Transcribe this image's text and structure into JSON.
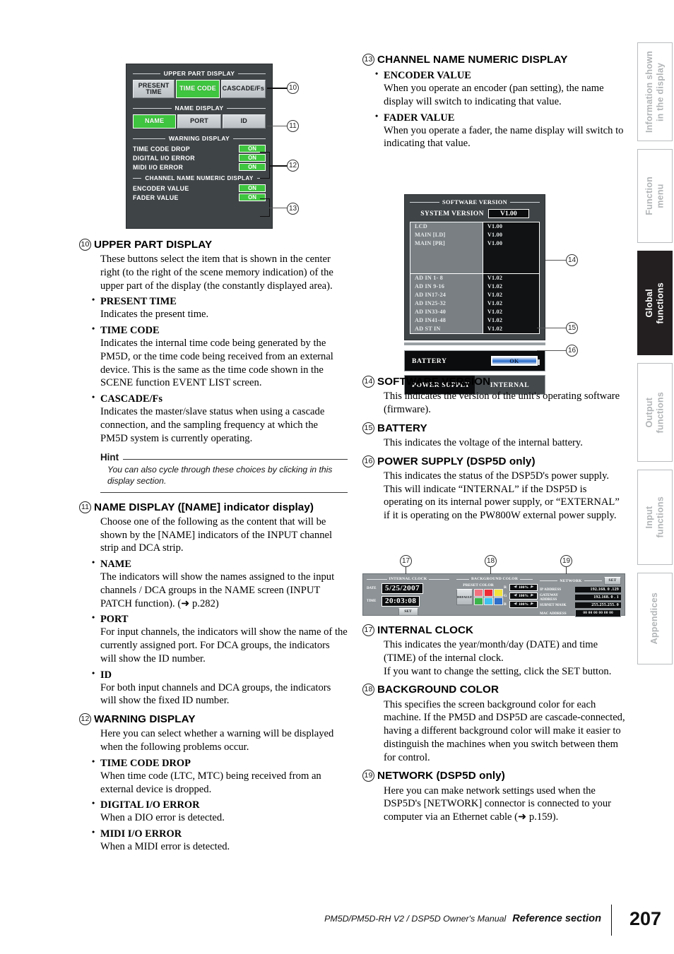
{
  "footer": {
    "manual": "PM5D/PM5D-RH V2 / DSP5D Owner's Manual",
    "section": "Reference section",
    "page": "207"
  },
  "tabs": [
    {
      "line1": "Information shown",
      "line2": "in the display",
      "active": false
    },
    {
      "line1": "Function",
      "line2": "menu",
      "active": false
    },
    {
      "line1": "Global",
      "line2": "functions",
      "active": true
    },
    {
      "line1": "Output",
      "line2": "functions",
      "active": false
    },
    {
      "line1": "Input",
      "line2": "functions",
      "active": false
    },
    {
      "line1": "Appendices",
      "line2": "",
      "active": false
    }
  ],
  "shot1": {
    "upper_part_display": {
      "title": "UPPER PART DISPLAY",
      "buttons": [
        {
          "label": "PRESENT\nTIME",
          "state": "off"
        },
        {
          "label": "TIME CODE",
          "state": "on"
        },
        {
          "label": "CASCADE/Fs",
          "state": "off"
        }
      ]
    },
    "name_display": {
      "title": "NAME DISPLAY",
      "buttons": [
        {
          "label": "NAME",
          "state": "on"
        },
        {
          "label": "PORT",
          "state": "off"
        },
        {
          "label": "ID",
          "state": "off"
        }
      ]
    },
    "warning_display": {
      "title": "WARNING DISPLAY",
      "rows": [
        {
          "label": "TIME CODE DROP",
          "value": "ON"
        },
        {
          "label": "DIGITAL I/O ERROR",
          "value": "ON"
        },
        {
          "label": "MIDI I/O ERROR",
          "value": "ON"
        }
      ]
    },
    "channel_name_numeric_display": {
      "title": "CHANNEL NAME NUMERIC DISPLAY",
      "rows": [
        {
          "label": "ENCODER VALUE",
          "value": "ON"
        },
        {
          "label": "FADER VALUE",
          "value": "ON"
        }
      ]
    },
    "callouts": [
      "10",
      "11",
      "12",
      "13"
    ]
  },
  "shot2": {
    "title": "SOFTWARE VERSION",
    "system_version_label": "SYSTEM VERSION",
    "system_version_value": "V1.00",
    "group_a": [
      {
        "name": "LCD",
        "version": "V1.00"
      },
      {
        "name": "MAIN [LD]",
        "version": "V1.00"
      },
      {
        "name": "MAIN [PR]",
        "version": "V1.00"
      }
    ],
    "group_b": [
      {
        "name": "AD IN 1- 8",
        "version": "V1.02"
      },
      {
        "name": "AD IN 9-16",
        "version": "V1.02"
      },
      {
        "name": "AD IN17-24",
        "version": "V1.02"
      },
      {
        "name": "AD IN25-32",
        "version": "V1.02"
      },
      {
        "name": "AD IN33-40",
        "version": "V1.02"
      },
      {
        "name": "AD IN41-48",
        "version": "V1.02"
      },
      {
        "name": "AD ST IN",
        "version": "V1.02"
      }
    ],
    "battery_label": "BATTERY",
    "battery_value": "OK",
    "power_supply_label": "POWER SUPPLY",
    "power_supply_value": "INTERNAL",
    "callouts": [
      "14",
      "15",
      "16"
    ]
  },
  "shot3": {
    "internal_clock": {
      "title": "INTERNAL CLOCK",
      "date_label": "DATE",
      "date_value": "5/25/2007",
      "time_label": "TIME",
      "time_value": "20:03:08",
      "set_label": "SET"
    },
    "background_color": {
      "title": "BACKGROUND COLOR",
      "preset_label": "PRESET COLOR",
      "default_label": "DEFAULT",
      "swatches": [
        "#f2727f",
        "#ee2b35",
        "#f2e23c",
        "#3bb54a",
        "#3fc0f0",
        "#2f6ec9"
      ],
      "rgb": [
        {
          "label": "R",
          "value": "100%"
        },
        {
          "label": "G",
          "value": "100%"
        },
        {
          "label": "B",
          "value": "100%"
        }
      ]
    },
    "network": {
      "title": "NETWORK",
      "set_label": "SET",
      "rows": [
        {
          "label": "IP ADDRESS",
          "value": "192.168.  0 .129"
        },
        {
          "label": "GATEWAY ADDRESS",
          "value": "192.168.  0 .  1"
        },
        {
          "label": "SUBNET MASK",
          "value": "255.255.255.  0"
        }
      ],
      "mac_label": "MAC ADDRESS",
      "mac_value": "00 00 00 00 00 00"
    },
    "callouts": [
      "17",
      "18",
      "19"
    ]
  },
  "left_column": {
    "s10": {
      "num": "10",
      "head": "UPPER PART DISPLAY",
      "body": "These buttons select the item that is shown in the center right (to the right of the scene memory indication) of the upper part of the display (the constantly displayed area).",
      "bullets": [
        {
          "head": "PRESENT TIME",
          "body": "Indicates the present time."
        },
        {
          "head": "TIME CODE",
          "body": "Indicates the internal time code being generated by the PM5D, or the time code being received from an external device. This is the same as the time code shown in the SCENE function EVENT LIST screen."
        },
        {
          "head": "CASCADE/Fs",
          "body": "Indicates the master/slave status when using a cascade connection, and the sampling frequency at which the PM5D system is currently operating."
        }
      ],
      "hint_title": "Hint",
      "hint_body": "You can also cycle through these choices by clicking in this display section."
    },
    "s11": {
      "num": "11",
      "head": "NAME DISPLAY ([NAME] indicator display)",
      "body": "Choose one of the following as the content that will be shown by the [NAME] indicators of the INPUT channel strip and DCA strip.",
      "bullets": [
        {
          "head": "NAME",
          "body": "The indicators will show the names assigned to the input channels / DCA groups in the NAME screen (INPUT PATCH function). (➜ p.282)"
        },
        {
          "head": "PORT",
          "body": "For input channels, the indicators will show the name of the currently assigned port. For DCA groups, the indicators will show the ID number."
        },
        {
          "head": "ID",
          "body": "For both input channels and DCA groups, the indicators will show the fixed ID number."
        }
      ]
    },
    "s12": {
      "num": "12",
      "head": "WARNING DISPLAY",
      "body": "Here you can select whether a warning will be displayed when the following problems occur.",
      "bullets": [
        {
          "head": "TIME CODE DROP",
          "body": "When time code (LTC, MTC) being received from an external device is dropped."
        },
        {
          "head": "DIGITAL I/O ERROR",
          "body": "When a DIO error is detected."
        },
        {
          "head": "MIDI I/O ERROR",
          "body": "When a MIDI error is detected."
        }
      ]
    }
  },
  "right_column": {
    "s13": {
      "num": "13",
      "head": "CHANNEL NAME NUMERIC DISPLAY",
      "bullets": [
        {
          "head": "ENCODER VALUE",
          "body": "When you operate an encoder (pan setting), the name display will switch to indicating that value."
        },
        {
          "head": "FADER VALUE",
          "body": "When you operate a fader, the name display will switch to indicating that value."
        }
      ]
    },
    "s14": {
      "num": "14",
      "head": "SOFTWARE VERSION",
      "body": "This indicates the version of the unit's operating software (firmware)."
    },
    "s15": {
      "num": "15",
      "head": "BATTERY",
      "body": "This indicates the voltage of the internal battery."
    },
    "s16": {
      "num": "16",
      "head": "POWER SUPPLY (DSP5D only)",
      "body": "This indicates the status of the DSP5D's power supply. This will indicate “INTERNAL” if the DSP5D is operating on its internal power supply, or “EXTERNAL” if it is operating on the PW800W external power supply."
    },
    "s17": {
      "num": "17",
      "head": "INTERNAL CLOCK",
      "body": "This indicates the year/month/day (DATE) and time (TIME) of the internal clock.\nIf you want to change the setting, click the SET button."
    },
    "s18": {
      "num": "18",
      "head": "BACKGROUND COLOR",
      "body": "This specifies the screen background color for each machine. If the PM5D and DSP5D are cascade-connected, having a different background color will make it easier to distinguish the machines when you switch between them for control."
    },
    "s19": {
      "num": "19",
      "head": "NETWORK (DSP5D only)",
      "body": "Here you can make network settings used when the DSP5D's [NETWORK] connector is connected to your computer via an Ethernet cable (➜ p.159)."
    }
  }
}
